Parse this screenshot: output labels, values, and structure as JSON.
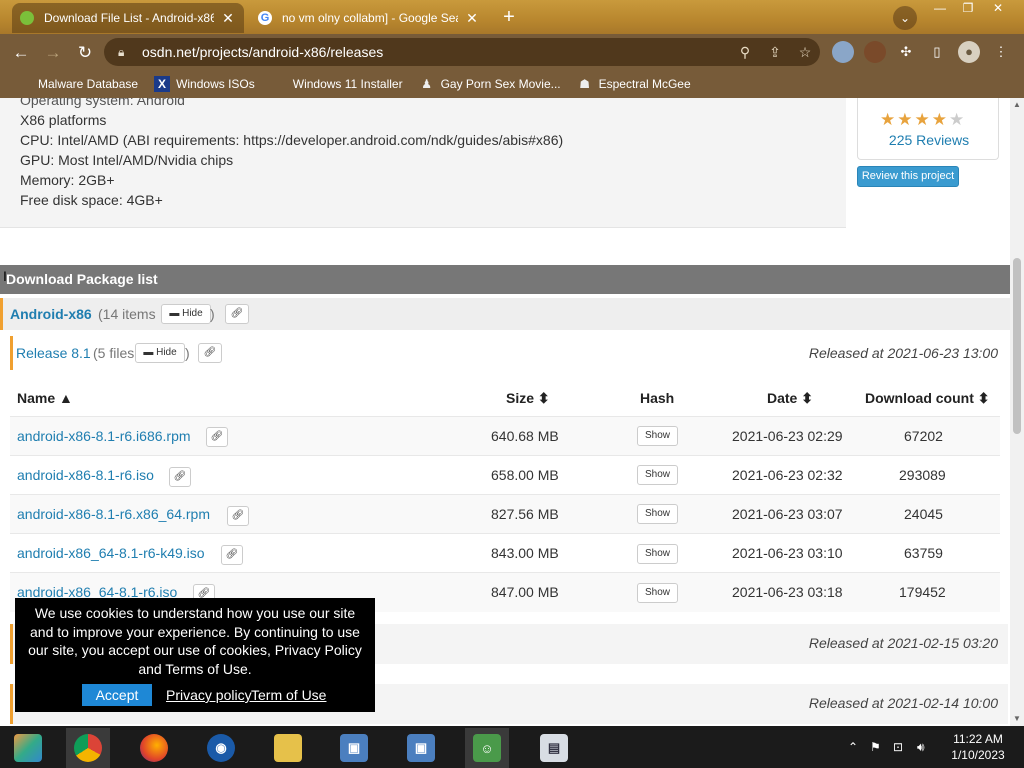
{
  "browser": {
    "tabs": [
      {
        "title": "Download File List - Android-x86",
        "active": true
      },
      {
        "title": "no vm olny collabm] - Google Sear",
        "active": false
      }
    ],
    "url": "osdn.net/projects/android-x86/releases",
    "bookmarks": [
      {
        "label": "Malware Database",
        "icon": "bookmark-blank-icon"
      },
      {
        "label": "Windows ISOs",
        "icon": "x-logo-icon"
      },
      {
        "label": "Windows 11 Installer",
        "icon": "bookmark-blank-icon"
      },
      {
        "label": "Gay Porn Sex Movie...",
        "icon": "site-logo-icon"
      },
      {
        "label": "Espectral McGee",
        "icon": "site-logo-icon"
      }
    ]
  },
  "requirements": {
    "lines": [
      "Operating system: Android",
      "X86 platforms",
      "CPU: Intel/AMD (ABI requirements: https://developer.android.com/ndk/guides/abis#x86)",
      "GPU: Most Intel/AMD/Nvidia chips",
      "Memory: 2GB+",
      "Free disk space: 4GB+"
    ]
  },
  "rating": {
    "stars": 4,
    "max_stars": 5,
    "reviews": "225 Reviews",
    "review_button": "Review this project"
  },
  "download": {
    "header": "Download Package list",
    "package": {
      "name": "Android-x86",
      "count": "(14 items",
      "hide": "Hide",
      "close": ")"
    },
    "release": {
      "name": "Release 8.1",
      "count": "(5 files",
      "hide": "Hide",
      "close": ")",
      "released": "Released at 2021-06-23 13:00"
    },
    "columns": {
      "name": "Name ▲",
      "size": "Size ⬍",
      "hash": "Hash",
      "date": "Date ⬍",
      "downloads": "Download count ⬍"
    },
    "files": [
      {
        "name": "android-x86-8.1-r6.i686.rpm",
        "size": "640.68 MB",
        "hash": "Show",
        "date": "2021-06-23 02:29",
        "downloads": "67202"
      },
      {
        "name": "android-x86-8.1-r6.iso",
        "size": "658.00 MB",
        "hash": "Show",
        "date": "2021-06-23 02:32",
        "downloads": "293089"
      },
      {
        "name": "android-x86-8.1-r6.x86_64.rpm",
        "size": "827.56 MB",
        "hash": "Show",
        "date": "2021-06-23 03:07",
        "downloads": "24045"
      },
      {
        "name": "android-x86_64-8.1-r6-k49.iso",
        "size": "843.00 MB",
        "hash": "Show",
        "date": "2021-06-23 03:10",
        "downloads": "63759"
      },
      {
        "name": "android-x86_64-8.1-r6.iso",
        "size": "847.00 MB",
        "hash": "Show",
        "date": "2021-06-23 03:18",
        "downloads": "179452"
      }
    ],
    "other_releases": [
      {
        "released": "Released at 2021-02-15 03:20"
      },
      {
        "released": "Released at 2021-02-14 10:00"
      }
    ]
  },
  "cookie": {
    "text": "We use cookies to understand how you use our site and to improve your experience. By continuing to use our site, you accept our use of cookies, Privacy Policy and Terms of Use.",
    "accept": "Accept",
    "privacy": "Privacy policy",
    "terms": "Term of Use"
  },
  "taskbar": {
    "time": "11:22 AM",
    "date": "1/10/2023"
  },
  "colors": {
    "link": "#1f7eb0",
    "accent_orange": "#f0a030",
    "header_gray": "#777777",
    "accept_blue": "#1e88d6"
  }
}
